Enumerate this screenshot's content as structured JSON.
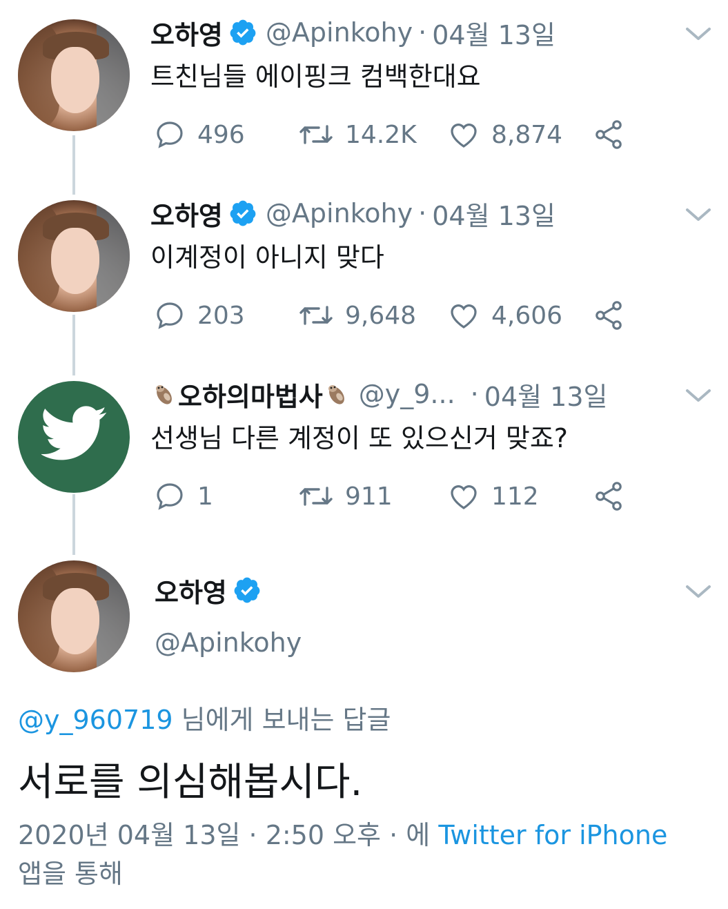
{
  "tweets": [
    {
      "name": "오하영",
      "handle": "@Apinkohy",
      "dot": "·",
      "date": "04월 13일",
      "text": "트친님들 에이핑크 컴백한대요",
      "replies": "496",
      "retweets": "14.2K",
      "likes": "8,874"
    },
    {
      "name": "오하영",
      "handle": "@Apinkohy",
      "dot": "·",
      "date": "04월 13일",
      "text": "이계정이 아니지 맞다",
      "replies": "203",
      "retweets": "9,648",
      "likes": "4,606"
    },
    {
      "name": "오하의마법사",
      "handle": "@y_9...",
      "dot": "·",
      "date": "04월 13일",
      "text": "선생님 다른 계정이 또 있으신거 맞죠?",
      "replies": "1",
      "retweets": "911",
      "likes": "112"
    }
  ],
  "focused": {
    "name": "오하영",
    "handle": "@Apinkohy",
    "reply_mention": "@y_960719",
    "reply_suffix": " 님에게 보내는 답글",
    "text": "서로를 의심해봅시다.",
    "meta_prefix": "2020년 04월 13일 · 2:50 오후 · 에 ",
    "source": "Twitter for iPhone",
    "meta_suffix": "앱을 통해"
  },
  "icons": {
    "verified": "verified-badge-icon",
    "reply": "reply-bubble-icon",
    "retweet": "retweet-icon",
    "like": "heart-icon",
    "share": "share-icon",
    "more": "chevron-down-icon",
    "emoji": "otter-emoji-icon"
  },
  "colors": {
    "text": "#14171a",
    "muted": "#657786",
    "link": "#1b95e0",
    "verified": "#1da1f2",
    "default_avatar": "#2f6d4d"
  }
}
